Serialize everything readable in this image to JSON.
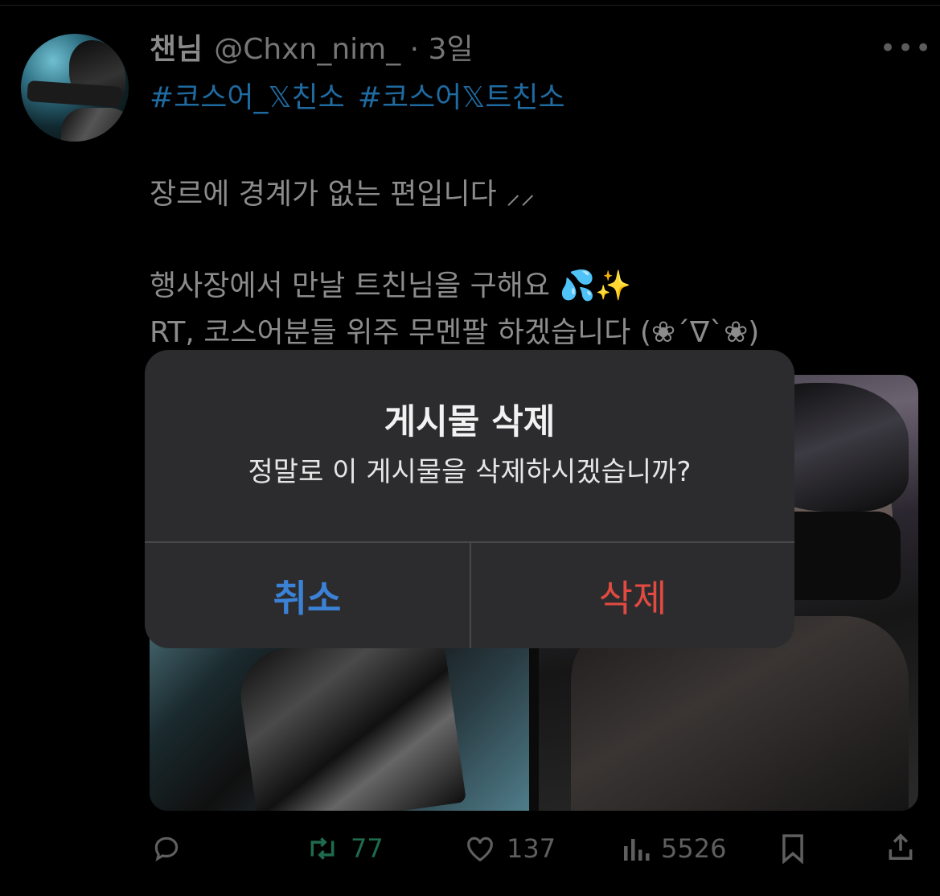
{
  "tweet": {
    "display_name": "챈님",
    "handle": "@Chxn_nim_",
    "time": "· 3일",
    "more_icon": "more-horizontal-icon",
    "hashtags": [
      "#코스어_𝕏친소",
      "#코스어𝕏트친소"
    ],
    "lines": [
      "장르에 경계가 없는 편입니다 ⸝⸝",
      "행사장에서 만날 트친님을 구해요 💦✨",
      "RT, 코스어분들 위주 무멘팔 하겠습니다 (❀´∇`❀)"
    ]
  },
  "actions": {
    "reply_icon": "reply-icon",
    "retweet_icon": "retweet-icon",
    "retweet_count": "77",
    "like_icon": "heart-icon",
    "like_count": "137",
    "views_icon": "views-icon",
    "views_count": "5526",
    "bookmark_icon": "bookmark-icon",
    "share_icon": "share-icon"
  },
  "dialog": {
    "title": "게시물 삭제",
    "message": "정말로 이 게시물을 삭제하시겠습니까?",
    "cancel_label": "취소",
    "delete_label": "삭제",
    "cancel_color": "#3b82d6",
    "delete_color": "#e14a40"
  }
}
